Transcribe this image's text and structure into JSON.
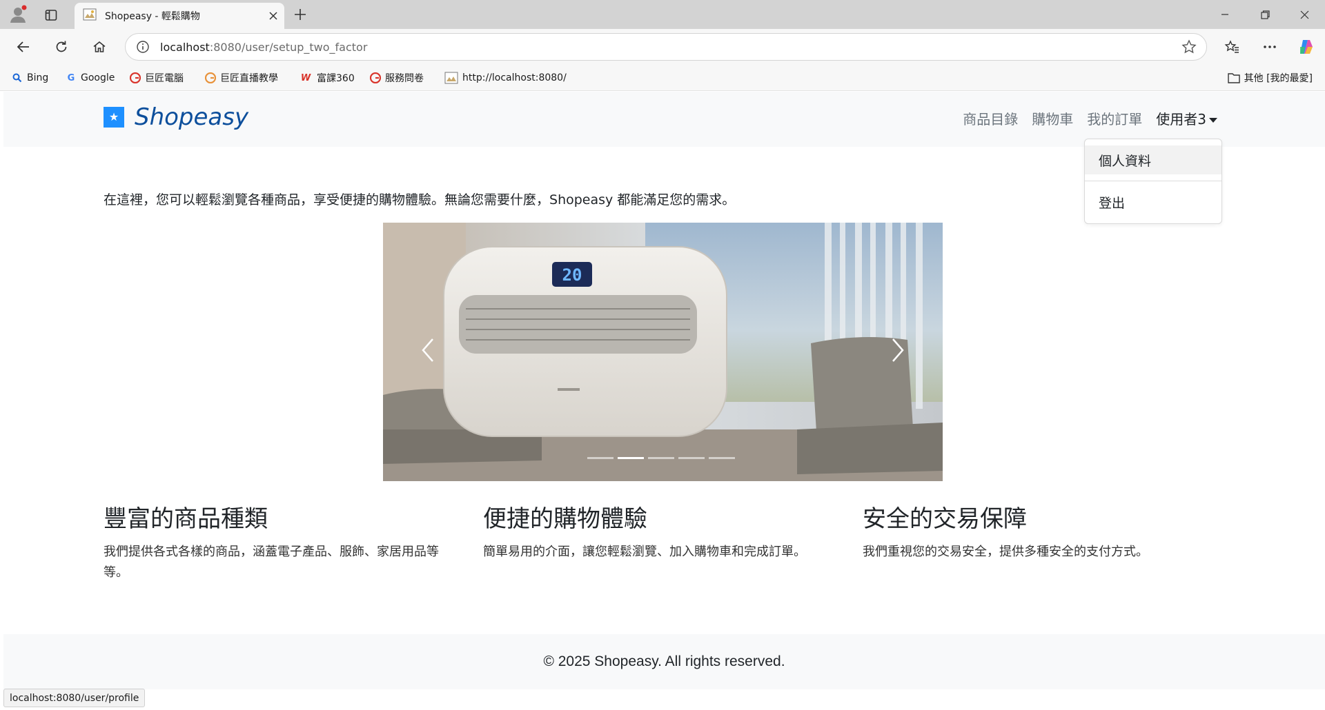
{
  "browser": {
    "tab_title": "Shopeasy - 輕鬆購物",
    "url_host": "localhost",
    "url_path": ":8080/user/setup_two_factor",
    "bookmarks": [
      {
        "label": "Bing",
        "icon": "bing-search-icon"
      },
      {
        "label": "Google",
        "icon": "google-icon"
      },
      {
        "label": "巨匠電腦",
        "icon": "gjun-icon"
      },
      {
        "label": "巨匠直播教學",
        "icon": "gjun-live-icon"
      },
      {
        "label": "富課360",
        "icon": "w-icon"
      },
      {
        "label": "服務問卷",
        "icon": "gjun-survey-icon"
      },
      {
        "label": "http://localhost:8080/",
        "icon": "broken-image-icon"
      }
    ],
    "other_favorites": "其他 [我的最愛]",
    "status_url": "localhost:8080/user/profile"
  },
  "site": {
    "brand": "Shopeasy",
    "nav": {
      "catalog": "商品目錄",
      "cart": "購物車",
      "orders": "我的訂單",
      "user": "使用者3"
    },
    "dropdown": {
      "profile": "個人資料",
      "logout": "登出"
    },
    "intro": "在這裡，您可以輕鬆瀏覽各種商品，享受便捷的購物體驗。無論您需要什麼，Shopeasy 都能滿足您的需求。",
    "carousel": {
      "slides": 5,
      "active_index": 1,
      "display_reading": "20"
    },
    "features": [
      {
        "title": "豐富的商品種類",
        "text": "我們提供各式各樣的商品，涵蓋電子產品、服飾、家居用品等等。"
      },
      {
        "title": "便捷的購物體驗",
        "text": "簡單易用的介面，讓您輕鬆瀏覽、加入購物車和完成訂單。"
      },
      {
        "title": "安全的交易保障",
        "text": "我們重視您的交易安全，提供多種安全的支付方式。"
      }
    ],
    "footer": "© 2025 Shopeasy. All rights reserved."
  },
  "colors": {
    "brand": "#0d4f9c",
    "logo": "#1e90ff",
    "nav_bg": "#f8f9fa"
  }
}
